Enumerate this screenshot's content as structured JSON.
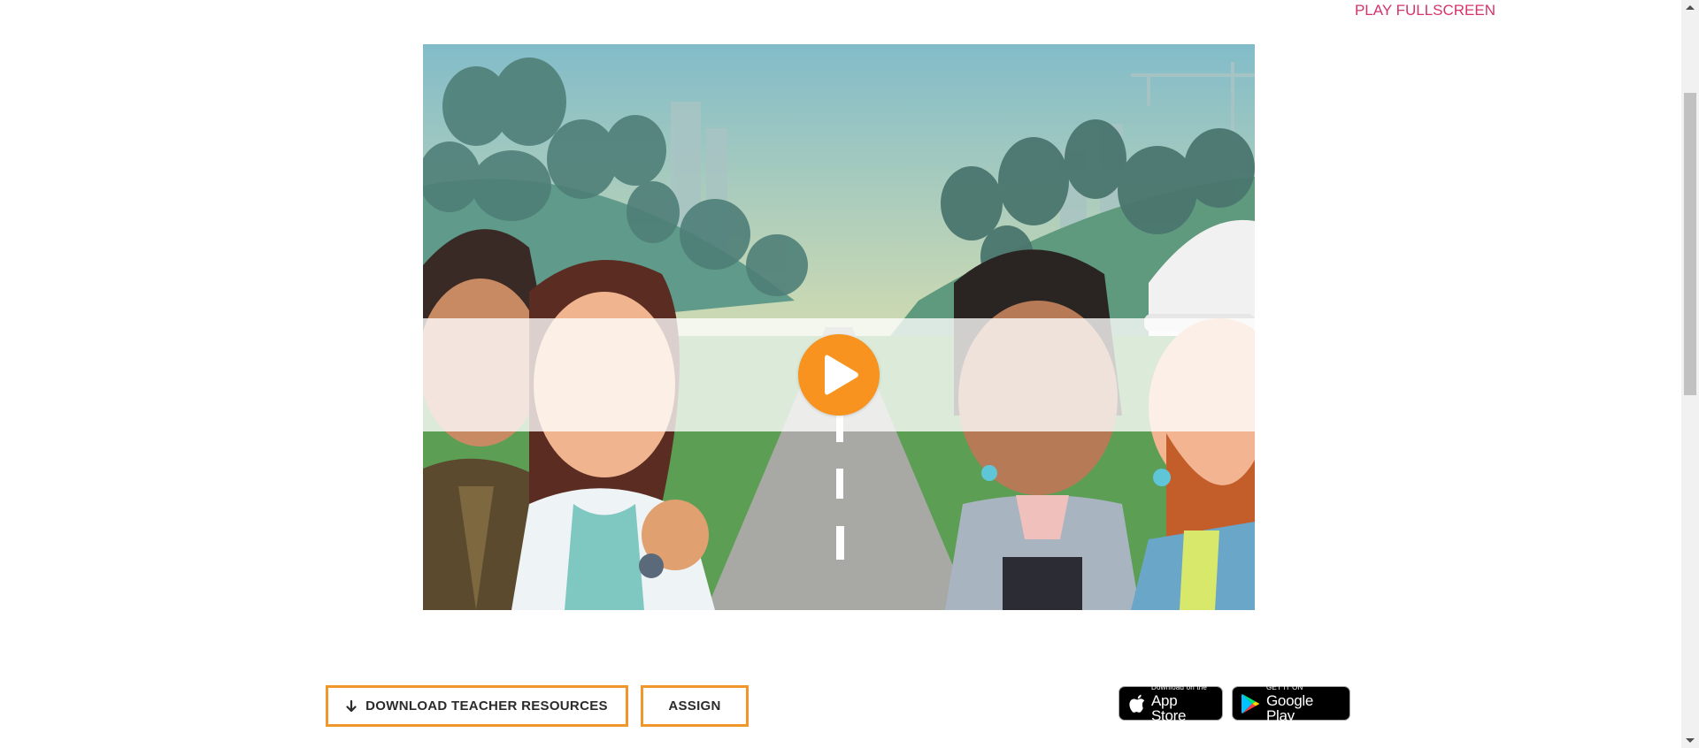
{
  "header": {
    "fullscreen_label": "PLAY FULLSCREEN"
  },
  "actions": {
    "download_label": "DOWNLOAD TEACHER RESOURCES",
    "assign_label": "ASSIGN"
  },
  "stores": {
    "apple_small": "Download on the",
    "apple_big": "App Store",
    "google_small": "GET IT ON",
    "google_big": "Google Play"
  },
  "icons": {
    "play": "play-icon",
    "download": "arrow-down-icon",
    "apple": "apple-logo-icon",
    "google": "google-play-logo-icon"
  },
  "colors": {
    "accent": "#f0962a",
    "link": "#d6336c",
    "play_button": "#f7931e"
  }
}
